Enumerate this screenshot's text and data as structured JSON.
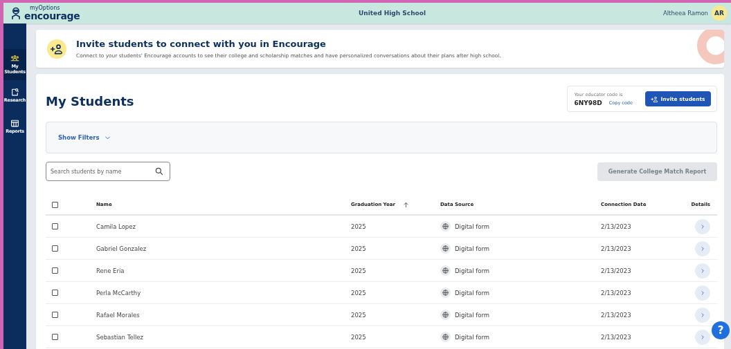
{
  "header": {
    "logo_small": "myOptions",
    "logo": "encourage",
    "school": "United High School",
    "user_name": "Altheea Ramon",
    "user_initials": "AR"
  },
  "sidebar": {
    "items": [
      {
        "label": "My Students",
        "kind": "students",
        "selected": true
      },
      {
        "label": "Research",
        "kind": "research",
        "selected": false
      },
      {
        "label": "Reports",
        "kind": "reports",
        "selected": false
      }
    ]
  },
  "banner": {
    "title": "Invite students to connect with you in Encourage",
    "text": "Connect to your students' Encourage accounts to see their college and scholarship matches and have personalized conversations about their plans after high school."
  },
  "page_title": "My Students",
  "educator_code": {
    "label": "Your educator code is",
    "code": "6NY98D",
    "copy": "Copy code",
    "invite_button": "Invite students"
  },
  "filters": {
    "label": "Show Filters",
    "expanded": false
  },
  "search": {
    "placeholder": "Search students by name"
  },
  "report_button": {
    "label": "Generate College Match Report",
    "disabled": true
  },
  "table": {
    "select_all_checked": false,
    "columns": [
      {
        "label": "Name",
        "sorted": false
      },
      {
        "label": "Graduation Year",
        "sorted": true
      },
      {
        "label": "Data Source",
        "sorted": false
      },
      {
        "label": "Connection Date",
        "sorted": false
      },
      {
        "label": "Details",
        "sorted": false
      }
    ],
    "rows": [
      {
        "checked": false,
        "name": "Camila Lopez",
        "year": "2025",
        "source": "Digital form",
        "date": "2/13/2023"
      },
      {
        "checked": false,
        "name": "Gabriel Gonzalez",
        "year": "2025",
        "source": "Digital form",
        "date": "2/13/2023"
      },
      {
        "checked": false,
        "name": "Rene Eria",
        "year": "2025",
        "source": "Digital form",
        "date": "2/13/2023"
      },
      {
        "checked": false,
        "name": "Perla McCarthy",
        "year": "2025",
        "source": "Digital form",
        "date": "2/13/2023"
      },
      {
        "checked": false,
        "name": "Rafael Morales",
        "year": "2025",
        "source": "Digital form",
        "date": "2/13/2023"
      },
      {
        "checked": false,
        "name": "Sebastian Tellez",
        "year": "2025",
        "source": "Digital form",
        "date": "2/13/2023"
      }
    ]
  },
  "help": {
    "label": "?"
  }
}
